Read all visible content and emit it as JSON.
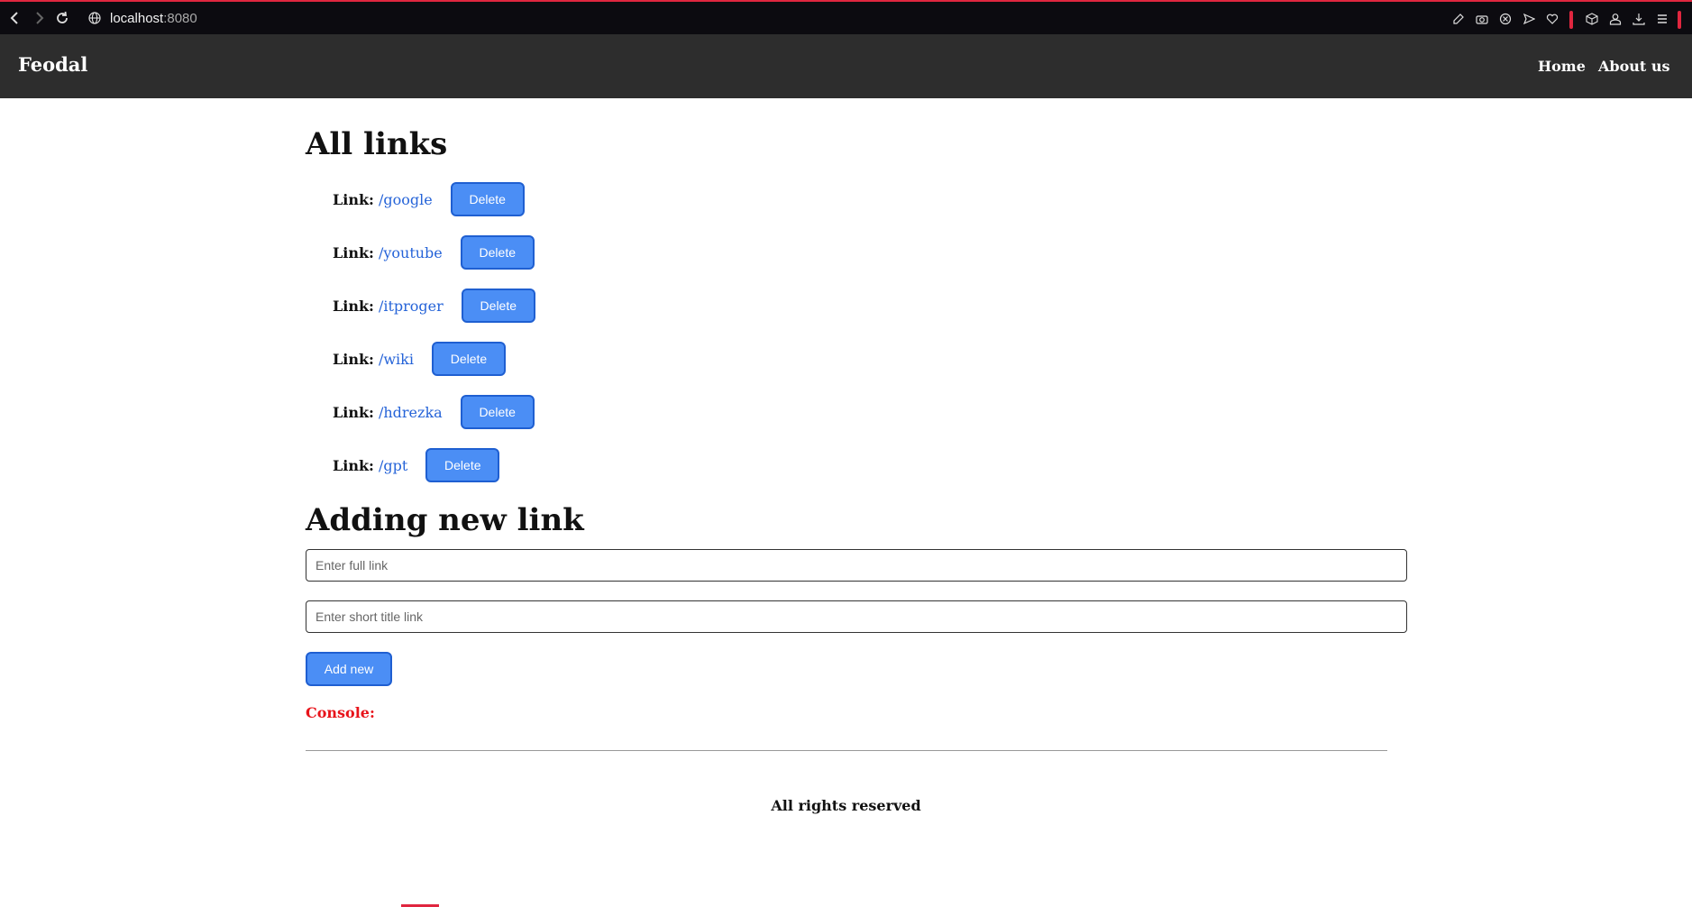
{
  "browser": {
    "url_host": "localhost",
    "url_port": ":8080",
    "back_icon": "chevron-left-icon",
    "forward_icon": "chevron-right-icon",
    "reload_icon": "reload-icon",
    "accent": "#e0263f"
  },
  "header": {
    "brand": "Feodal",
    "nav": [
      "Home",
      "About us"
    ],
    "background": "#2d2d2d"
  },
  "links_section": {
    "title": "All links",
    "label": "Link:",
    "delete_label": "Delete",
    "items": [
      "/google",
      "/youtube",
      "/itproger",
      "/wiki",
      "/hdrezka",
      "/gpt"
    ]
  },
  "add_section": {
    "title": "Adding new link",
    "full_link_placeholder": "Enter full link",
    "short_title_placeholder": "Enter short title link",
    "add_label": "Add new",
    "console_label": "Console:"
  },
  "footer": {
    "text": "All rights reserved"
  },
  "colors": {
    "button": "#4b8ef5",
    "link": "#2563d8",
    "console": "#e8131a"
  }
}
